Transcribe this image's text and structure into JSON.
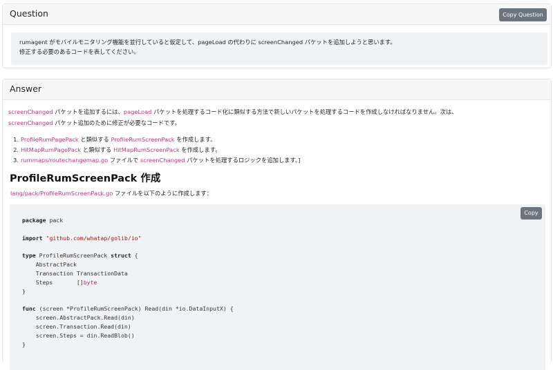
{
  "question": {
    "header": "Question",
    "copy_label": "Copy Question",
    "line1": "rumagent がモバイルモニタリング機能を並行していると仮定して、pageLoad の代わりに screenChanged パケットを追加しようと思います。",
    "line2": "修正する必要のあるコードを表してください。"
  },
  "answer": {
    "header": "Answer",
    "intro": {
      "l1_pink1": "screenChanged",
      "l1_text1": " パケットを追加するには、",
      "l1_pink2": "pageLoad",
      "l1_text2": " パケットを処理するコード化に類似する方法で新しいパケットを処理するコードを作成しなければなりません。次は、",
      "l2_pink": "screenChanged",
      "l2_text": " パケット追加のために修正が必要なコードです。"
    },
    "list": [
      {
        "num": "1.",
        "a": "ProfileRumPagePack",
        "b": " と類似する ",
        "c": "ProfileRumScreenPack",
        "d": " を作成します。"
      },
      {
        "num": "2.",
        "a": "HitMapRumPagePack",
        "b": " と類似する ",
        "c": "HitMapRumScreenPack",
        "d": " を作成します。"
      },
      {
        "num": "3.",
        "a": "rummaps/routechangemap.go",
        "b": " ファイルで ",
        "c": "screenChanged",
        "d": " パケットを処理するロジックを追加します。]"
      }
    ],
    "section_title": "ProfileRumScreenPack 作成",
    "file_path": "lang/pack/ProfileRumScreenPack.go",
    "file_text": " ファイルを以下のように作成します：",
    "copy_code_label": "Copy"
  },
  "code": {
    "pkg_kw": "package",
    "pkg_name": " pack",
    "import_kw": "import",
    "import_path": "\"github.com/whatap/golib/io\"",
    "type_kw": "type",
    "type_name": " ProfileRumScreenPack ",
    "struct_kw": "struct",
    "brace_open": " {",
    "f1": "    AbstractPack",
    "f2": "    Transaction TransactionData",
    "f3": "    Steps       []",
    "f3_type": "byte",
    "brace_close": "}",
    "func_kw": "func",
    "func_sig": " (screen *ProfileRumScreenPack) Read(din *io.DataInputX) {",
    "b1": "    screen.AbstractPack.Read(din)",
    "b2": "    screen.Transaction.Read(din)",
    "b3": "    screen.Steps = din.ReadBlob()",
    "b4": "}"
  }
}
